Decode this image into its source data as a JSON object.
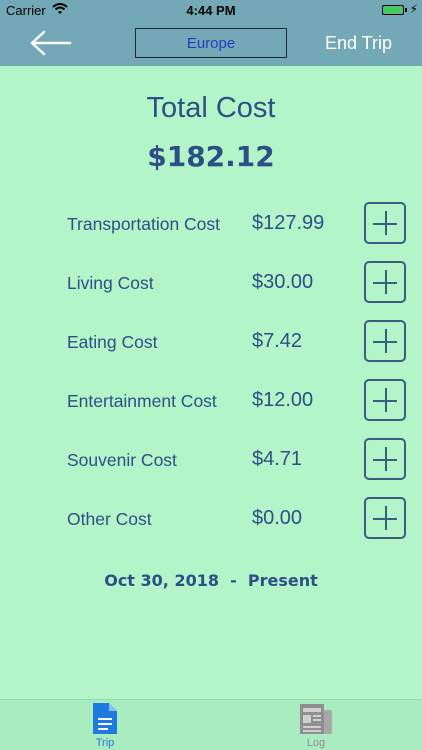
{
  "status_bar": {
    "carrier": "Carrier",
    "time": "4:44 PM",
    "battery_level": 1.0
  },
  "nav": {
    "title": "Europe",
    "end_trip_label": "End Trip",
    "back_icon": "arrow-left-icon"
  },
  "total": {
    "title": "Total Cost",
    "value": "$182.12"
  },
  "costs": [
    {
      "label": "Transportation Cost",
      "amount": "$127.99"
    },
    {
      "label": "Living Cost",
      "amount": "$30.00"
    },
    {
      "label": "Eating Cost",
      "amount": "$7.42"
    },
    {
      "label": "Entertainment Cost",
      "amount": "$12.00"
    },
    {
      "label": "Souvenir Cost",
      "amount": "$4.71"
    },
    {
      "label": "Other Cost",
      "amount": "$0.00"
    }
  ],
  "date_range": "Oct 30, 2018  -  Present",
  "tabs": [
    {
      "label": "Trip",
      "icon": "document-icon",
      "active": true,
      "color": "#1f7ae0"
    },
    {
      "label": "Log",
      "icon": "newspaper-icon",
      "active": false,
      "color": "#8f8f8f"
    }
  ],
  "colors": {
    "background": "#b3f5c9",
    "nav_bar": "#73a9b7",
    "text": "#2d4f86",
    "active_tab": "#1f7ae0"
  }
}
